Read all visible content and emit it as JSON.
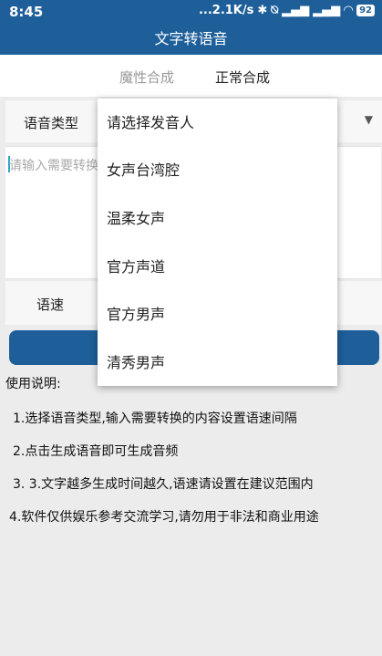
{
  "status_bar": {
    "time": "8:45",
    "network": "...2.1K/s",
    "battery": "92"
  },
  "app_bar": {
    "title": "文字转语音"
  },
  "tabs": [
    {
      "label": "魔性合成",
      "active": false
    },
    {
      "label": "正常合成",
      "active": true
    }
  ],
  "voice_type": {
    "label": "语音类型"
  },
  "text_input": {
    "placeholder": "请输入需要转换"
  },
  "speed": {
    "label": "语速"
  },
  "instructions": {
    "title": "使用说明:",
    "items": [
      "1.选择语音类型,输入需要转换的内容设置语速间隔",
      "2.点击生成语音即可生成音频",
      "3. 3.文字越多生成时间越久,语速请设置在建议范围内",
      "4.软件仅供娱乐参考交流学习,请勿用于非法和商业用途"
    ]
  },
  "dropdown": {
    "options": [
      "请选择发音人",
      "女声台湾腔",
      "温柔女声",
      "官方声道",
      "官方男声",
      "清秀男声"
    ]
  },
  "colors": {
    "primary": "#1e5f9a",
    "background": "#ececec"
  }
}
